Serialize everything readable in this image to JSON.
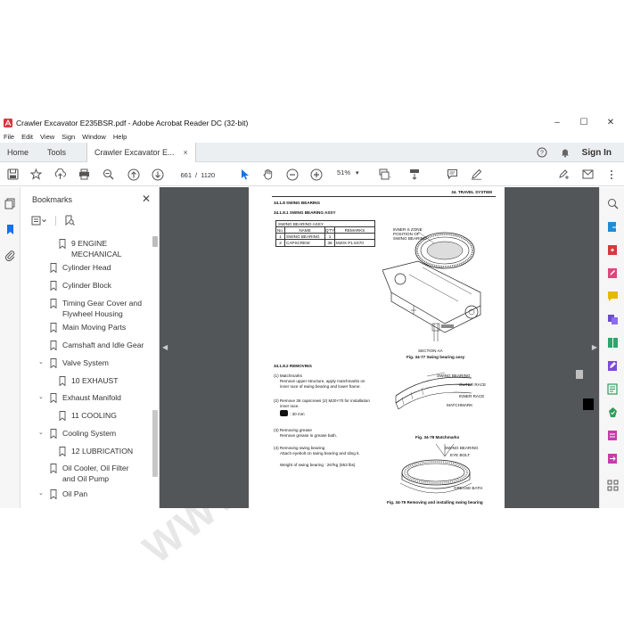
{
  "window": {
    "title": "Crawler Excavator E235BSR.pdf - Adobe Acrobat Reader DC (32-bit)",
    "controls": [
      "–",
      "☐",
      "✕"
    ]
  },
  "menu": [
    "File",
    "Edit",
    "View",
    "Sign",
    "Window",
    "Help"
  ],
  "tabs": {
    "home": "Home",
    "tools": "Tools",
    "doc": "Crawler Excavator E...",
    "doc_close": "×",
    "sign_in": "Sign In"
  },
  "toolbar": {
    "current_page": "661",
    "page_sep": "/",
    "total_pages": "1120",
    "zoom": "51%",
    "zoom_caret": "▾"
  },
  "bookmarks": {
    "title": "Bookmarks",
    "close": "✕",
    "items": [
      {
        "label": "9 ENGINE MECHANICAL",
        "line2": "MECHANICAL",
        "line1": "9 ENGINE",
        "indent": 1,
        "chevron": ""
      },
      {
        "label": "Cylinder Head",
        "indent": 0,
        "chevron": ""
      },
      {
        "label": "Cylinder Block",
        "indent": 0,
        "chevron": ""
      },
      {
        "label": "Timing Gear Cover and Flywheel Housing",
        "line1": "Timing Gear Cover and",
        "line2": "Flywheel Housing",
        "indent": 0,
        "chevron": ""
      },
      {
        "label": "Main Moving Parts",
        "indent": 0,
        "chevron": ""
      },
      {
        "label": "Camshaft and Idle Gear",
        "indent": 0,
        "chevron": ""
      },
      {
        "label": "Valve System",
        "indent": 0,
        "chevron": "⌄"
      },
      {
        "label": "10 EXHAUST",
        "indent": 1,
        "chevron": ""
      },
      {
        "label": "Exhaust Manifold",
        "indent": 0,
        "chevron": "⌄"
      },
      {
        "label": "11 COOLING",
        "indent": 1,
        "chevron": ""
      },
      {
        "label": "Cooling System",
        "indent": 0,
        "chevron": "⌄"
      },
      {
        "label": "12 LUBRICATION",
        "indent": 1,
        "chevron": ""
      },
      {
        "label": "Oil Cooler, Oil Filter and Oil Pump",
        "line1": "Oil Cooler, Oil Filter",
        "line2": "and Oil Pump",
        "indent": 0,
        "chevron": ""
      },
      {
        "label": "Oil Pan",
        "indent": 0,
        "chevron": "⌄"
      }
    ]
  },
  "pdf_page": {
    "header_right": "34. TRAVEL SYSTEM",
    "sec_1": "34.1.8      SWING BEARING",
    "sec_2": "34.1.8.1      SWING BEARING ASSY",
    "table_title": "SWING BEARING ASSY",
    "table_head": [
      "No.",
      "NAME",
      "Q'TY",
      "REMARKS"
    ],
    "row1": [
      "1",
      "SWING BEARING",
      "1",
      ""
    ],
    "row2": [
      "2",
      "CAPSCREW",
      "36",
      "M20X P1.5X70"
    ],
    "callout_1": "INNER S ZONE",
    "callout_2": "POSITION OF",
    "callout_3": "SWING BEARING",
    "section_aa": "SECTION AA",
    "fig_77": "Fig. 34-77 Swing bearing assy",
    "sec_3": "34.1.8.2      REMOVING",
    "step1_t": "(1)  Matchmarks",
    "step1_a": "Remove upper structure, apply matchmarks on",
    "step1_b": "inner race of swing bearing and lower frame.",
    "step2_a": "(2)  Remove 36 capscrews (2) M20×70 for installation",
    "step2_b": "inner race.",
    "step2_c": ": 30 mm",
    "step3_t": "(3)  Removing grease",
    "step3_a": "Remove grease in grease bath.",
    "step4_t": "(4)  Removing swing bearing",
    "step4_a": "Attach eyebolt on swing bearing and sling it.",
    "step4_b": "Weight of swing bearing : 267kg (553 lbs)",
    "lbl_swing": "SWING BEARING",
    "lbl_outer": "OUTER RACE",
    "lbl_inner": "INNER RACE",
    "lbl_match": "MATCHMARK",
    "fig_78": "Fig. 34-78 Matchmarks",
    "lbl_swing2": "SWING BEARING",
    "lbl_eye": "EYE BOLT",
    "lbl_grease": "GREASE BATH",
    "fig_79": "Fig. 34-79 Removing and installing swing bearing"
  },
  "watermark": "WWW.EPCDEPOT.COM",
  "colors": {
    "viewer_bg": "#525659",
    "accent_blue": "#1473e6",
    "pdf_red": "#d7373f"
  }
}
